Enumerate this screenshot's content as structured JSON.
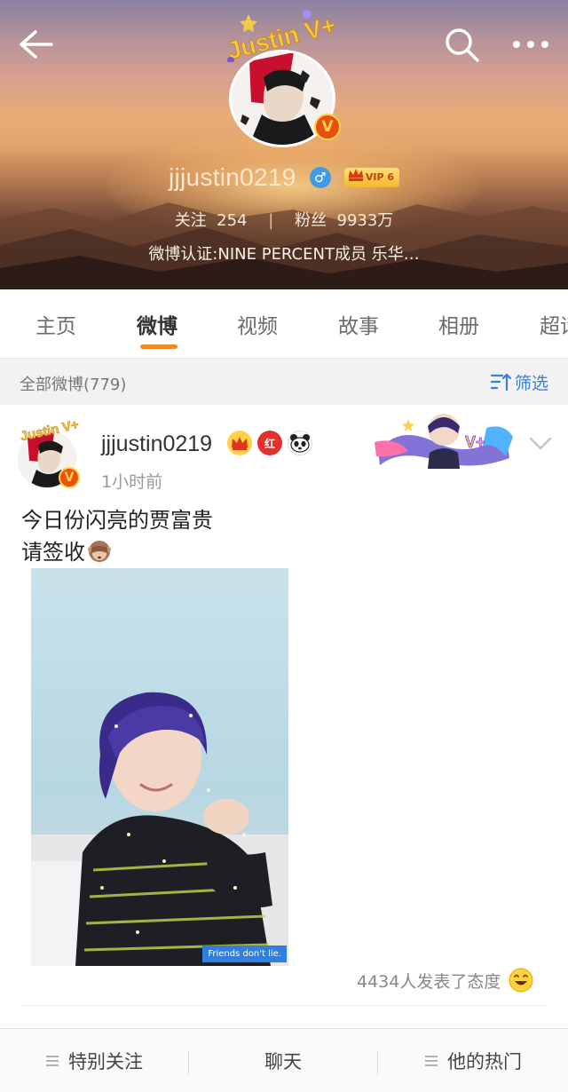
{
  "header": {
    "avatar_deco_text": "Justin V+",
    "username": "jjjustin0219",
    "vip_label": "VIP 6",
    "following_label": "关注",
    "following_count": "254",
    "followers_label": "粉丝",
    "followers_count": "9933万",
    "verification": "微博认证:NINE PERCENT成员 乐华…",
    "verified_mark": "V",
    "gender_symbol": "♂"
  },
  "tabs": [
    {
      "label": "主页"
    },
    {
      "label": "微博"
    },
    {
      "label": "视频"
    },
    {
      "label": "故事"
    },
    {
      "label": "相册"
    },
    {
      "label": "超话"
    }
  ],
  "active_tab": "微博",
  "filter": {
    "count_label": "全部微博(779)",
    "filter_label": "筛选"
  },
  "post": {
    "author": "jjjustin0219",
    "time": "1小时前",
    "line1": "今日份闪亮的贾富贵",
    "line2": "请签收",
    "red_badge": "红",
    "image_caption": "Friends don't lie.",
    "reactions": "4434人发表了态度"
  },
  "bottom_bar": {
    "special_follow": "特别关注",
    "chat": "聊天",
    "hot": "他的热门"
  },
  "colors": {
    "accent": "#f08a26",
    "link": "#3a7fd0",
    "verified": "#e8500f"
  }
}
